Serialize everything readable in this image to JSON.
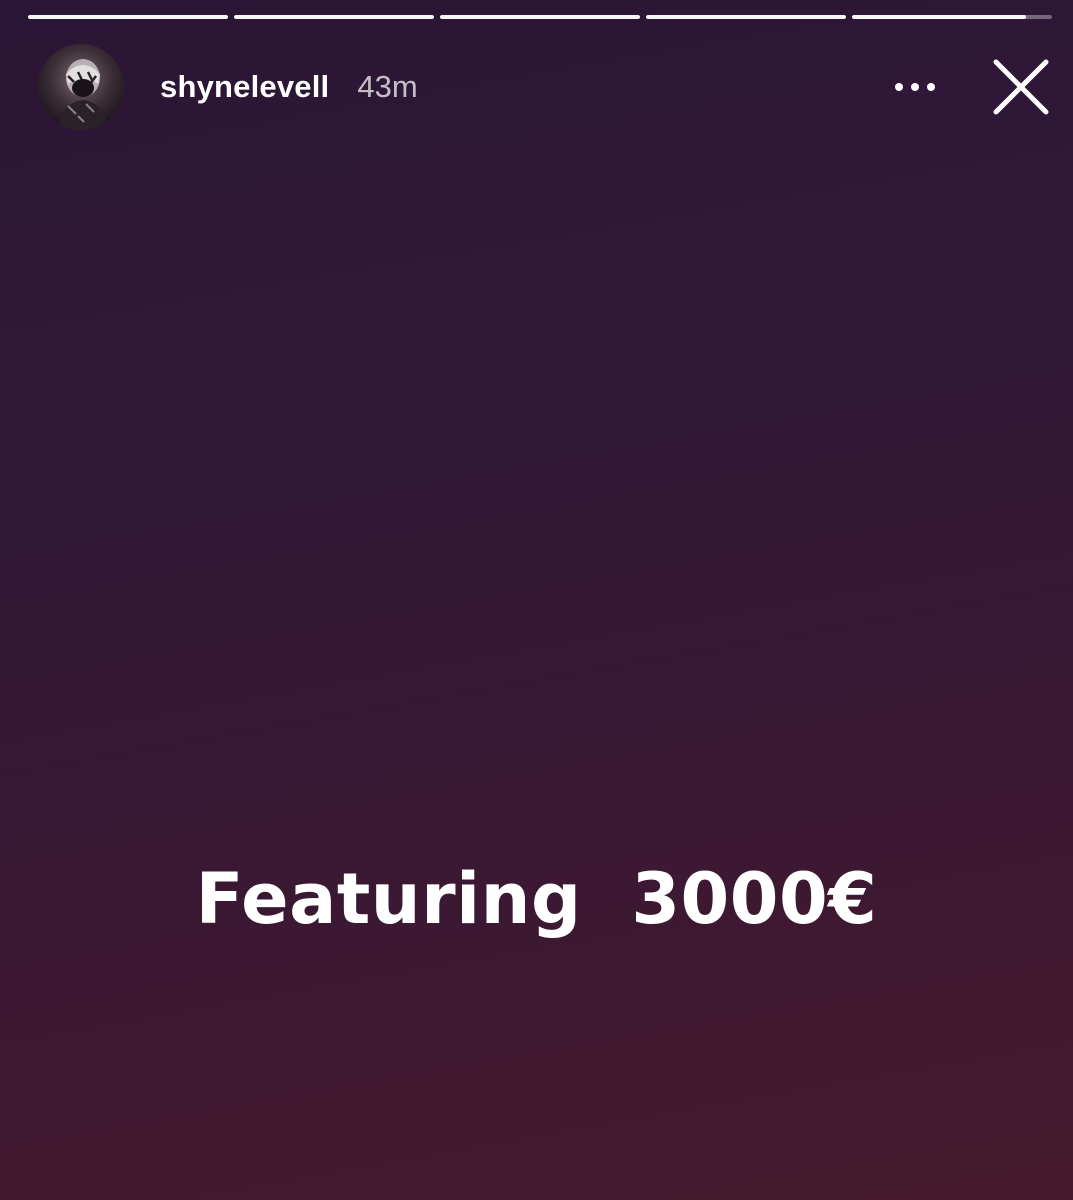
{
  "progress": {
    "segments": [
      1,
      1,
      1,
      1,
      0.87
    ]
  },
  "header": {
    "username": "shynelevell",
    "time": "43m",
    "more_icon": "more-horizontal-icon",
    "close_icon": "close-icon"
  },
  "story": {
    "text": "Featuring  3000€"
  },
  "colors": {
    "background_top": "#2a1636",
    "background_bottom": "#451a2c",
    "text": "#ffffff"
  }
}
